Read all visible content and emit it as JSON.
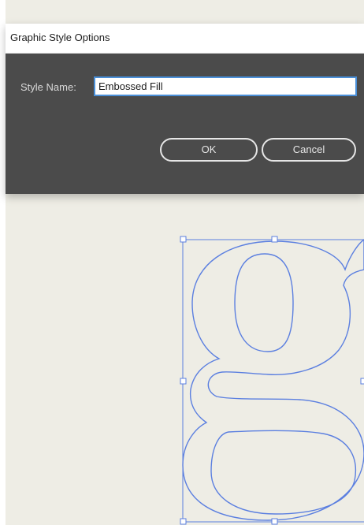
{
  "dialog": {
    "title": "Graphic Style Options",
    "style_name_label": "Style Name:",
    "style_name_value": "Embossed Fill",
    "ok_label": "OK",
    "cancel_label": "Cancel"
  },
  "canvas": {
    "background_color": "#eeede5",
    "selection_color": "#5b7fe0"
  }
}
